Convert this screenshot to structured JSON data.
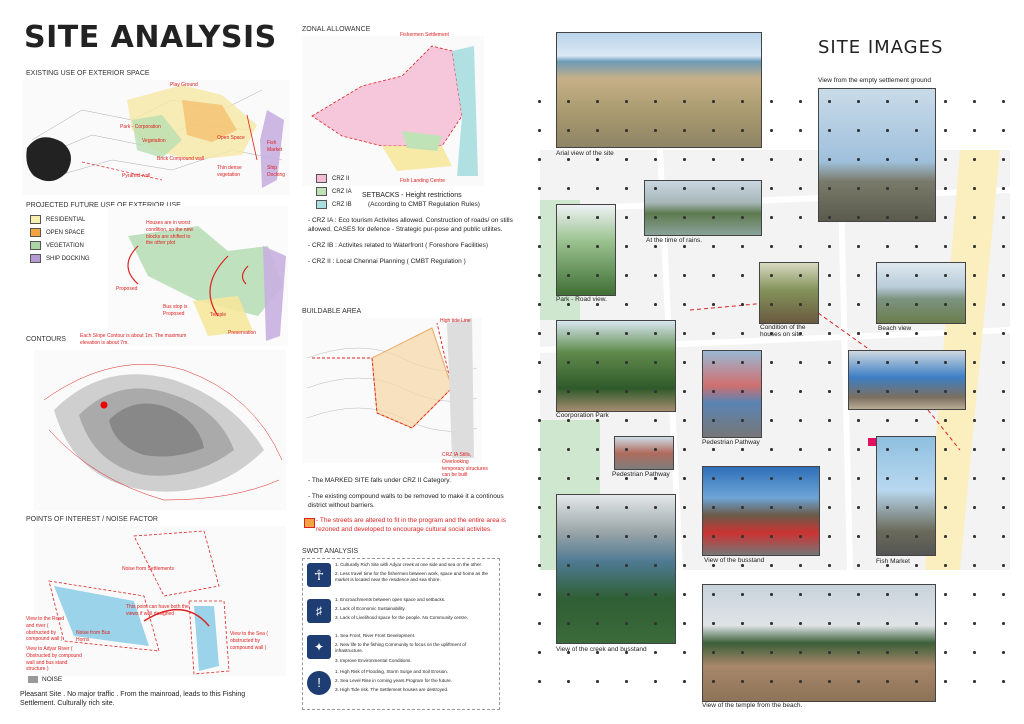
{
  "left": {
    "title": "SITE ANALYSIS",
    "existing_use": {
      "heading": "EXISTING USE OF EXTERIOR SPACE",
      "labels": [
        "Play Ground",
        "Park - Corporation",
        "Vegetation",
        "Brick Compound wall",
        "Open Space",
        "Fish Market",
        "Ship Docking",
        "Pyramid wall",
        "Thin dense vegetation"
      ]
    },
    "projected_use": {
      "heading": "PROJECTED FUTURE USE OF EXTERIOR USE",
      "legend": [
        {
          "label": "RESIDENTIAL",
          "color": "#f7efb0"
        },
        {
          "label": "OPEN SPACE",
          "color": "#f4a340"
        },
        {
          "label": "VEGETATION",
          "color": "#a9d6a4"
        },
        {
          "label": "SHIP DOCKING",
          "color": "#b69ad4"
        }
      ],
      "labels": [
        "Houses are in worst condition, so the new blocks are shifted to the other plot",
        "Proposed",
        "Bus stop is Proposed",
        "Temple",
        "Preservation"
      ]
    },
    "contours": {
      "heading": "CONTOURS",
      "note": "Each Slope Contour is about 1m. The maximum elevation is about 7m."
    },
    "points": {
      "heading": "POINTS OF INTEREST / NOISE FACTOR",
      "labels": [
        "Noise from Settlements",
        "This point can have both the views if well designed",
        "View to the Road and river ( obstructed by compound wall )",
        "Noise from Bus Horns",
        "View to Adyar River ( Obstructed by compound wall and bus stand structure )",
        "View to the Sea ( obstructed by compound wall )"
      ],
      "noise_label": "NOISE",
      "footer": "Pleasant Site . No major traffic . From the mainroad, leads to this Fishing Settlement. Culturally rich site."
    }
  },
  "middle": {
    "zonal": {
      "heading": "ZONAL ALLOWANCE",
      "map_labels": [
        "Fishermen Settlement",
        "Fish Landing Centre"
      ],
      "legend": [
        {
          "label": "CRZ II",
          "color": "#f5bcd4"
        },
        {
          "label": "CRZ IA",
          "color": "#bfe3b7"
        },
        {
          "label": "CRZ IB",
          "color": "#a9dde0"
        }
      ],
      "setbacks": "SETBACKS - Height restrictions",
      "setbacks_sub": "(According to CMBT Regulation Rules)",
      "notes": [
        "- CRZ IA : Eco tourism Activites allowed. Construction of roads/ on stills allowed. CASES for defence - Strategic pur-pose and public utilites.",
        "- CRZ IB : Activites related to Waterfront ( Foreshore Facilities)",
        "- CRZ II : Local Chennai Planning ( CMBT Regulation )"
      ]
    },
    "buildable": {
      "heading": "BUILDABLE AREA",
      "map_labels": [
        "High tide Line",
        "CRZ IA Stills, Overlooking temporary structures can be built"
      ],
      "notes": [
        "- The MARKED SITE falls under CRZ II Category.",
        "- The existing compound walls to be removed to make it a continous district without barriers."
      ],
      "red_note": "- The streets are altered to fit in the program and the entire area is rezoned and developed to encourage cultural social activites."
    },
    "swot": {
      "heading": "SWOT ANALYSIS",
      "groups": [
        {
          "items": [
            "1. Culturally Rich Site with Adyar creek at one side and sea on the other.",
            "2. Less travel time for the fishermen between work, space and home as the market is located near the residence and sea shore."
          ]
        },
        {
          "items": [
            "1. Encroachments between open space and setbacks.",
            "2. Lack of Economic Sustainability.",
            "3. Lack of Livelihood space for the people. No Community centre."
          ]
        },
        {
          "items": [
            "1. Sea Front, River Front Development.",
            "2. New life to the fishing Community to focus on the upliftment of infrastructure.",
            "3. Improve Environmental Conditions."
          ]
        },
        {
          "items": [
            "1. High Risk of Flooding, Storm Surge and Soil Erosion.",
            "2. Sea Level Rise in coming years.Program for the future.",
            "3. High Tide risk. The Settlement houses are destroyed."
          ]
        }
      ]
    }
  },
  "right": {
    "title": "SITE IMAGES",
    "captions": {
      "arial": "Arial view of the site",
      "empty": "View from the empty settlement ground",
      "rains": "At the time of rains.",
      "park_road": "Park - Road view.",
      "houses": "Condition of the houses on site.",
      "beach": "Beach view",
      "corp_park": "Coorporation Park",
      "ped1": "Pedestrian Pathway",
      "ped2": "Pedestrian Pathway",
      "busstand": "View of the busstand",
      "fish": "Fish Market",
      "creek": "View of the creek and busstand",
      "temple": "View of the temple from the beach."
    }
  }
}
